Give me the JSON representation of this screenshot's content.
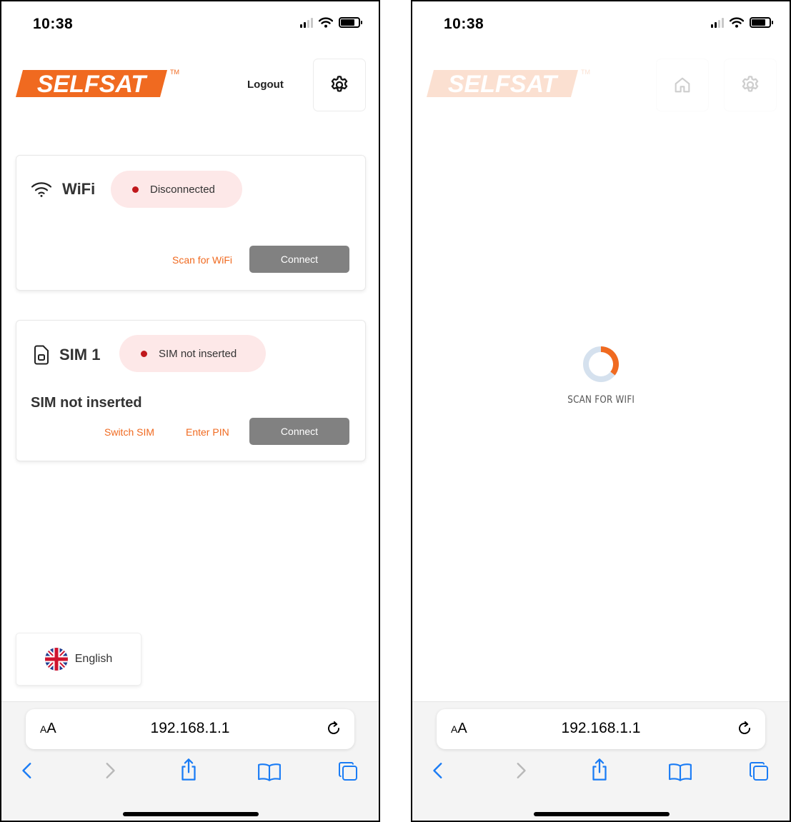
{
  "status": {
    "time": "10:38"
  },
  "brand": {
    "logo_text": "SELFSAT",
    "trademark": "TM"
  },
  "header": {
    "logout_label": "Logout"
  },
  "wifi_card": {
    "title": "WiFi",
    "status": "Disconnected",
    "scan_label": "Scan for WiFi",
    "connect_label": "Connect"
  },
  "sim_card": {
    "title": "SIM 1",
    "status": "SIM not inserted",
    "message": "SIM not inserted",
    "switch_label": "Switch SIM",
    "pin_label": "Enter PIN",
    "connect_label": "Connect"
  },
  "language": {
    "label": "English"
  },
  "browser": {
    "aa_small": "A",
    "aa_big": "A",
    "url": "192.168.1.1"
  },
  "loading": {
    "label": "SCAN FOR WIFI"
  },
  "colors": {
    "accent": "#f06a20",
    "pill_bg": "#fde8e8",
    "dot": "#c0181c",
    "button": "#818181",
    "ios_blue": "#1a7cf5"
  },
  "icons": [
    "wifi-icon",
    "sim-card-icon",
    "settings-gear-icon",
    "home-icon",
    "uk-flag-icon",
    "reload-icon",
    "back-icon",
    "forward-icon",
    "share-icon",
    "bookmarks-icon",
    "tabs-icon"
  ]
}
